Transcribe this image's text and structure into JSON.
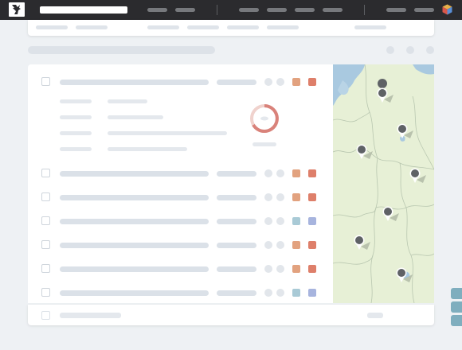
{
  "app": {
    "name": "",
    "logo": "deer-antler-logo-icon"
  },
  "topbar": {
    "nav_left": [
      "",
      ""
    ],
    "nav_middle": [
      "",
      "",
      "",
      ""
    ],
    "nav_right": [
      "",
      ""
    ],
    "apps_icon": "cube-icon"
  },
  "list": {
    "rows": [
      {
        "tag_colors": [
          "#e2a27f",
          "#de7f6a"
        ]
      },
      {
        "tag_colors": [
          "#e2a27f",
          "#de7f6a"
        ]
      },
      {
        "tag_colors": [
          "#e2a27f",
          "#de7f6a"
        ]
      },
      {
        "tag_colors": [
          "#a9cad6",
          "#a7b4de"
        ]
      },
      {
        "tag_colors": [
          "#e2a27f",
          "#de7f6a"
        ]
      },
      {
        "tag_colors": [
          "#e2a27f",
          "#de7f6a"
        ]
      },
      {
        "tag_colors": [
          "#a9cad6",
          "#a7b4de"
        ]
      }
    ],
    "detail_state": "loading"
  },
  "map": {
    "land_color": "#e7f0d6",
    "water_color": "#a9c9e0",
    "marker_icon": "map-pin-icon",
    "marker_count": 7
  },
  "colors": {
    "topbar": "#2b2b2e",
    "accent_tab": "#7faebe",
    "spinner": "#d9827a"
  }
}
